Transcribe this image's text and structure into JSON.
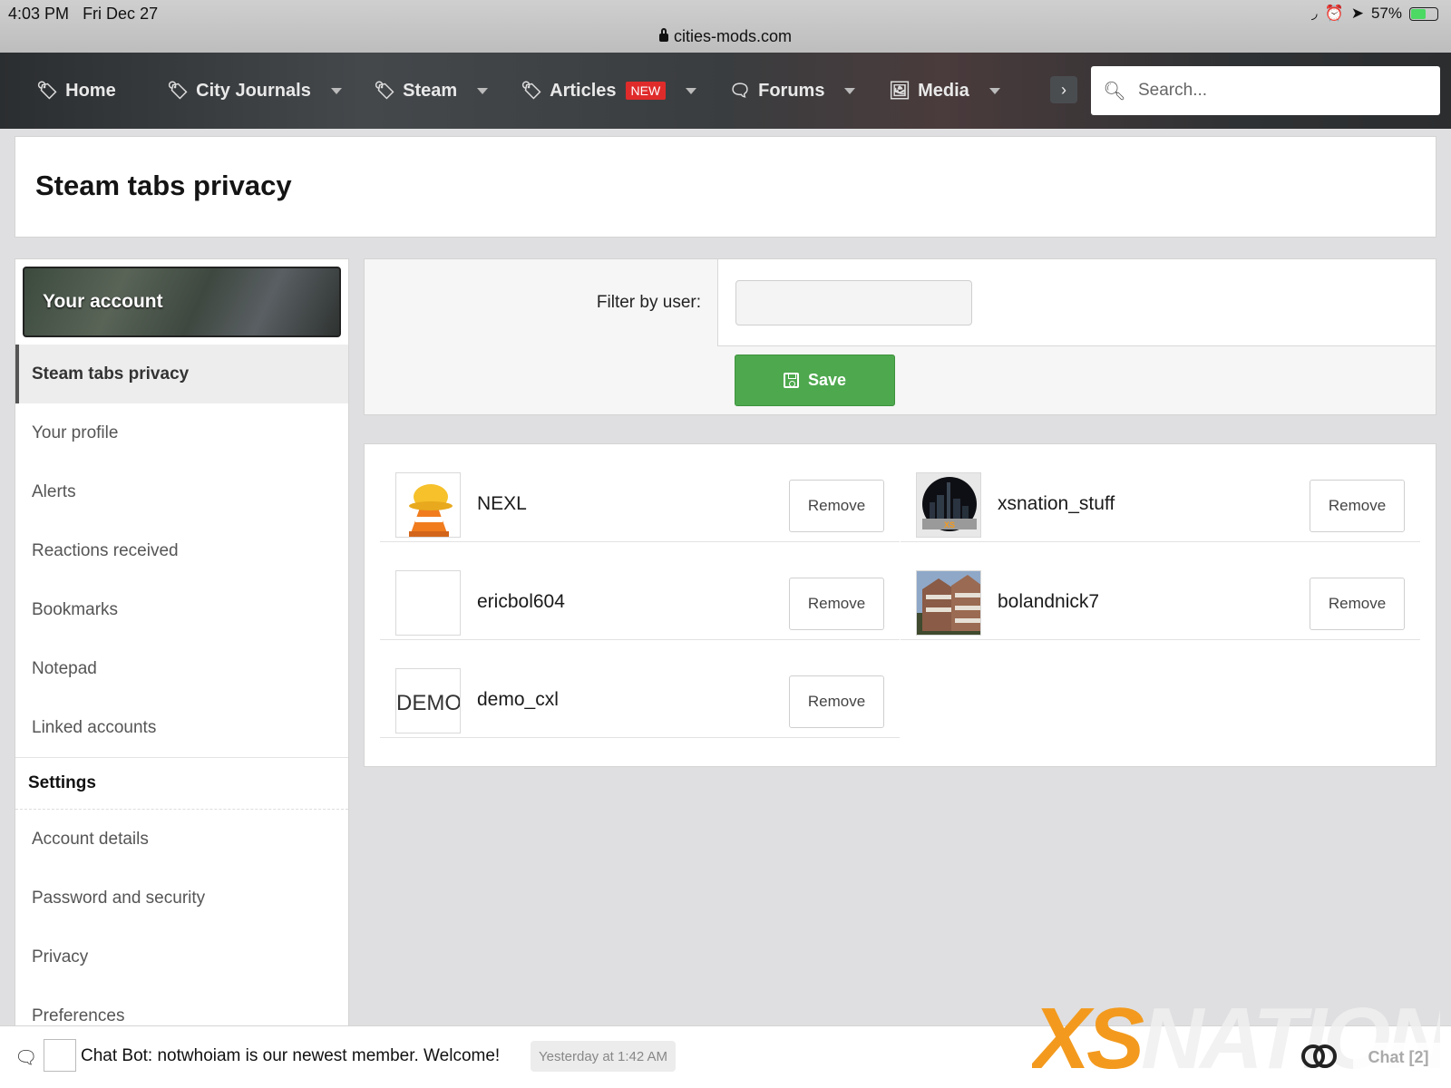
{
  "status_bar": {
    "time": "4:03 PM",
    "date": "Fri Dec 27",
    "url": "cities-mods.com",
    "battery": "57%",
    "battery_level": 0.57
  },
  "nav": {
    "items": [
      {
        "label": "Home",
        "icon": "tag-icon"
      },
      {
        "label": "City Journals",
        "icon": "tag-icon"
      },
      {
        "label": "Steam",
        "icon": "tag-icon"
      },
      {
        "label": "Articles",
        "icon": "tag-icon",
        "badge": "NEW"
      },
      {
        "label": "Forums",
        "icon": "comments-icon"
      },
      {
        "label": "Media",
        "icon": "image-icon"
      }
    ],
    "search_placeholder": "Search..."
  },
  "page": {
    "title": "Steam tabs privacy"
  },
  "sidebar": {
    "header": "Your account",
    "items": [
      "Steam tabs privacy",
      "Your profile",
      "Alerts",
      "Reactions received",
      "Bookmarks",
      "Notepad",
      "Linked accounts"
    ],
    "settings_heading": "Settings",
    "settings_items": [
      "Account details",
      "Password and security",
      "Privacy",
      "Preferences"
    ]
  },
  "filter": {
    "label": "Filter by user:",
    "value": "",
    "save_label": "Save"
  },
  "users": [
    {
      "name": "NEXL",
      "avatar": "construction-cone-icon"
    },
    {
      "name": "xsnation_stuff",
      "avatar": "night-city-logo"
    },
    {
      "name": "ericbol604",
      "avatar": "blank-avatar"
    },
    {
      "name": "bolandnick7",
      "avatar": "apartment-building-photo"
    },
    {
      "name": "demo_cxl",
      "avatar": "demo-logo",
      "avatar_text": "DEMO"
    }
  ],
  "remove_label": "Remove",
  "chat": {
    "message": "Chat Bot: notwhoiam is our newest member. Welcome!",
    "time": "Yesterday at 1:42 AM",
    "label": "Chat [2]",
    "brand_xs": "XS",
    "brand_nation": "NATION"
  },
  "colors": {
    "save_green": "#4ea84e",
    "new_badge": "#e02b2b",
    "brand_orange": "#f39a1e"
  }
}
